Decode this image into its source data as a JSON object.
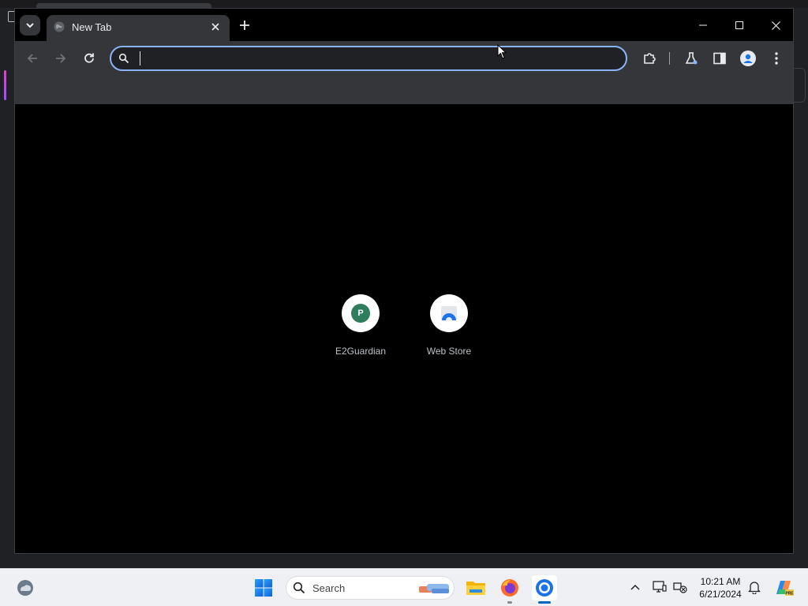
{
  "browser": {
    "tab": {
      "title": "New Tab"
    },
    "omnibox": {
      "value": "",
      "placeholder": ""
    }
  },
  "new_tab_page": {
    "shortcuts": [
      {
        "label": "E2Guardian",
        "badge_letter": "P",
        "badge_color": "#2e7d5b"
      },
      {
        "label": "Web Store"
      }
    ]
  },
  "taskbar": {
    "search_placeholder": "Search",
    "clock": {
      "time": "10:21 AM",
      "date": "6/21/2024"
    }
  },
  "colors": {
    "omnibox_focus": "#8ab4f8",
    "toolbar": "#35363a",
    "tab_strip": "#000000",
    "page_background": "#000000",
    "taskbar": "#eef0f4",
    "taskbar_active_indicator": "#0067c0"
  },
  "icons": [
    "tab-search-icon",
    "globe-icon",
    "close-icon",
    "plus-icon",
    "minimize-icon",
    "maximize-icon",
    "back-icon",
    "forward-icon",
    "reload-icon",
    "search-icon",
    "extensions-icon",
    "labs-icon",
    "side-panel-icon",
    "profile-icon",
    "menu-icon",
    "windows-start-icon",
    "file-explorer-icon",
    "firefox-icon",
    "chrome-icon",
    "chevron-up-icon",
    "display-icon",
    "network-icon",
    "bell-icon",
    "copilot-icon",
    "weather-icon"
  ]
}
